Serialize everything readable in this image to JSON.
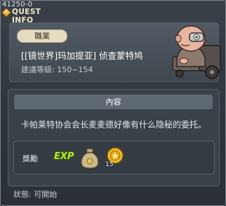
{
  "window": {
    "id": "41250-0",
    "title": "QUEST INFO"
  },
  "job": {
    "badge": "職業",
    "quest_name": "[[镜世界]玛加提亚] 侦查蒙特鸠",
    "level": "建議等級: 150~154"
  },
  "content": {
    "header": "內容",
    "description": "卡帕莱特协会会长麦麦德好像有什么隐秘的委托。"
  },
  "reward": {
    "label": "獎勵",
    "exp_icon_text": "EXP",
    "items": [
      {
        "icon": "money-bag-icon"
      },
      {
        "icon": "gold-coin-icon",
        "count": "15"
      }
    ]
  },
  "status": "狀態: 可開始",
  "colors": {
    "background": "#2e343b",
    "accent_title": "#f3e9c8",
    "exp_green": "#b6e340"
  }
}
